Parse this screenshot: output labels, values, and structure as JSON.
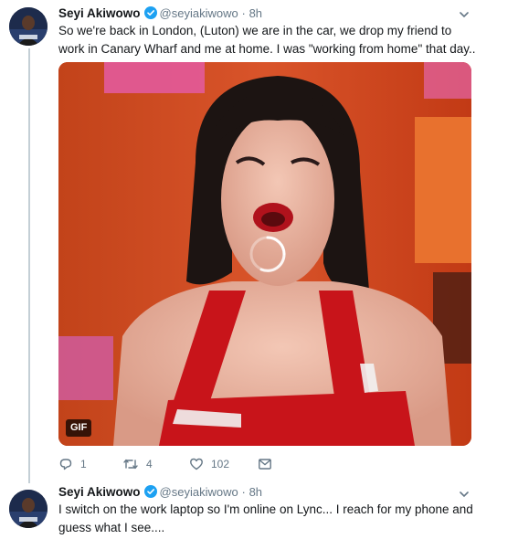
{
  "tweets": [
    {
      "name": "Seyi Akiwowo",
      "handle": "@seyiakiwowo",
      "separator": "·",
      "time": "8h",
      "text": "So we're back in London, (Luton) we are in the car, we drop my friend to work in Canary Wharf and me at home. I was \"working from home\" that day..",
      "media": {
        "badge": "GIF",
        "loading": true
      },
      "actions": {
        "reply_count": "1",
        "retweet_count": "4",
        "like_count": "102"
      }
    },
    {
      "name": "Seyi Akiwowo",
      "handle": "@seyiakiwowo",
      "separator": "·",
      "time": "8h",
      "text": "I switch on the work laptop so I'm online on Lync... I reach for my phone and guess what I see...."
    }
  ],
  "colors": {
    "verified": "#1da1f2",
    "secondary_text": "#657786",
    "thread_line": "#c4cfd6"
  },
  "icons": [
    "verified-badge-icon",
    "chevron-down-icon",
    "reply-icon",
    "retweet-icon",
    "like-icon",
    "message-icon"
  ]
}
